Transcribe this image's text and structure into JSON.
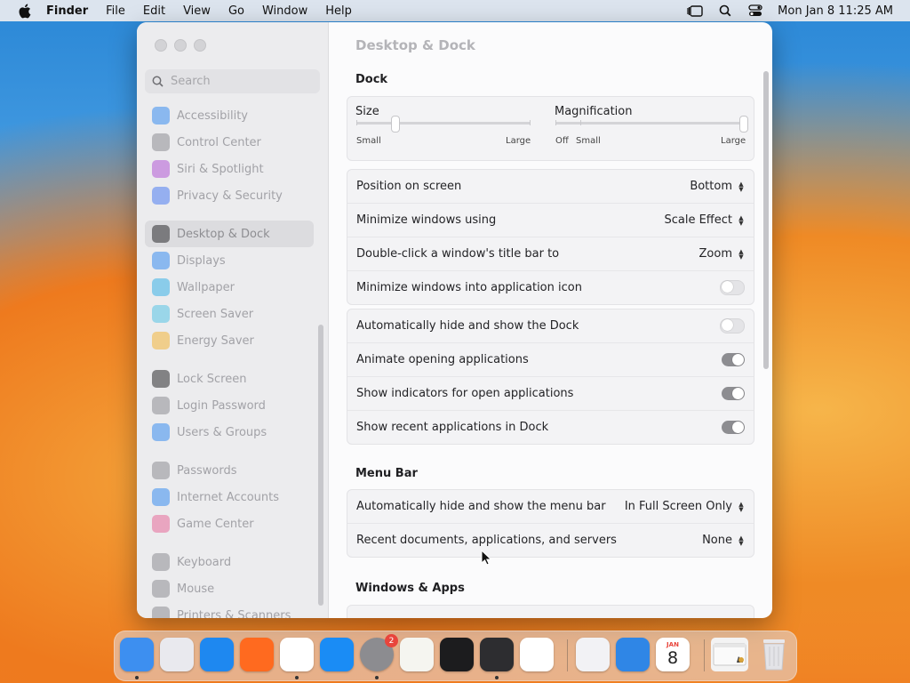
{
  "menubar": {
    "app": "Finder",
    "items": [
      "File",
      "Edit",
      "View",
      "Go",
      "Window",
      "Help"
    ],
    "clock": "Mon Jan 8  11:25 AM"
  },
  "search": {
    "placeholder": "Search"
  },
  "sidebar": {
    "items": [
      {
        "label": "Accessibility",
        "icon": "accessibility-icon",
        "color": "#3a8ef0"
      },
      {
        "label": "Control Center",
        "icon": "control-center-icon",
        "color": "#8e8e93"
      },
      {
        "label": "Siri & Spotlight",
        "icon": "siri-icon",
        "color": "#b35ad6"
      },
      {
        "label": "Privacy & Security",
        "icon": "hand-icon",
        "color": "#4f7ef2"
      },
      {
        "label": "Desktop & Dock",
        "icon": "dock-icon",
        "color": "#2b2b2e"
      },
      {
        "label": "Displays",
        "icon": "displays-icon",
        "color": "#3a8ef0"
      },
      {
        "label": "Wallpaper",
        "icon": "wallpaper-icon",
        "color": "#3ab2e8"
      },
      {
        "label": "Screen Saver",
        "icon": "screen-saver-icon",
        "color": "#57c4e5"
      },
      {
        "label": "Energy Saver",
        "icon": "energy-icon",
        "color": "#f4b73a"
      },
      {
        "label": "Lock Screen",
        "icon": "lock-icon",
        "color": "#2b2b2e"
      },
      {
        "label": "Login Password",
        "icon": "lock-icon",
        "color": "#8e8e93"
      },
      {
        "label": "Users & Groups",
        "icon": "users-icon",
        "color": "#3a8ef0"
      },
      {
        "label": "Passwords",
        "icon": "key-icon",
        "color": "#8e8e93"
      },
      {
        "label": "Internet Accounts",
        "icon": "at-icon",
        "color": "#3a8ef0"
      },
      {
        "label": "Game Center",
        "icon": "game-center-icon",
        "color": "#e86c9a"
      },
      {
        "label": "Keyboard",
        "icon": "keyboard-icon",
        "color": "#8e8e93"
      },
      {
        "label": "Mouse",
        "icon": "mouse-icon",
        "color": "#8e8e93"
      },
      {
        "label": "Printers & Scanners",
        "icon": "printer-icon",
        "color": "#8e8e93"
      }
    ]
  },
  "page": {
    "title": "Desktop & Dock"
  },
  "dock_section": {
    "heading": "Dock",
    "size": {
      "title": "Size",
      "min": "Small",
      "max": "Large",
      "level": 0.22
    },
    "magnification": {
      "title": "Magnification",
      "off": "Off",
      "min": "Small",
      "max": "Large",
      "level": 1.0
    },
    "popups": [
      {
        "label": "Position on screen",
        "value": "Bottom"
      },
      {
        "label": "Minimize windows using",
        "value": "Scale Effect"
      },
      {
        "label": "Double-click a window's title bar to",
        "value": "Zoom"
      }
    ],
    "minimize_into_icon": {
      "label": "Minimize windows into application icon",
      "on": false
    },
    "toggles": [
      {
        "label": "Automatically hide and show the Dock",
        "on": false
      },
      {
        "label": "Animate opening applications",
        "on": true
      },
      {
        "label": "Show indicators for open applications",
        "on": true
      },
      {
        "label": "Show recent applications in Dock",
        "on": true
      }
    ]
  },
  "menu_bar_section": {
    "heading": "Menu Bar",
    "rows": [
      {
        "label": "Automatically hide and show the menu bar",
        "value": "In Full Screen Only"
      },
      {
        "label": "Recent documents, applications, and servers",
        "value": "None"
      }
    ]
  },
  "windows_section": {
    "heading": "Windows & Apps"
  },
  "dock": {
    "apps": [
      {
        "name": "finder-icon",
        "color": "#3d8ff0"
      },
      {
        "name": "launchpad-icon",
        "color": "#e9e9ee"
      },
      {
        "name": "safari-icon",
        "color": "#1e88f0"
      },
      {
        "name": "firefox-icon",
        "color": "#ff6a1f"
      },
      {
        "name": "chrome-icon",
        "color": "#ffffff"
      },
      {
        "name": "app-store-icon",
        "color": "#1a8cf5"
      },
      {
        "name": "system-settings-icon",
        "color": "#8c8c90"
      },
      {
        "name": "textedit-icon",
        "color": "#f5f5f0"
      },
      {
        "name": "terminal-icon",
        "color": "#1c1c1e"
      },
      {
        "name": "instruments-icon",
        "color": "#2d2d30"
      },
      {
        "name": "vscode-icon",
        "color": "#ffffff"
      },
      {
        "name": "visual-studio-icon",
        "color": "#f2f2f5"
      },
      {
        "name": "weather-icon",
        "color": "#2f86e6"
      },
      {
        "name": "calendar-icon",
        "color": "#ffffff"
      }
    ],
    "settings_badge": "2",
    "calendar_month": "JAN",
    "calendar_day": "8"
  }
}
